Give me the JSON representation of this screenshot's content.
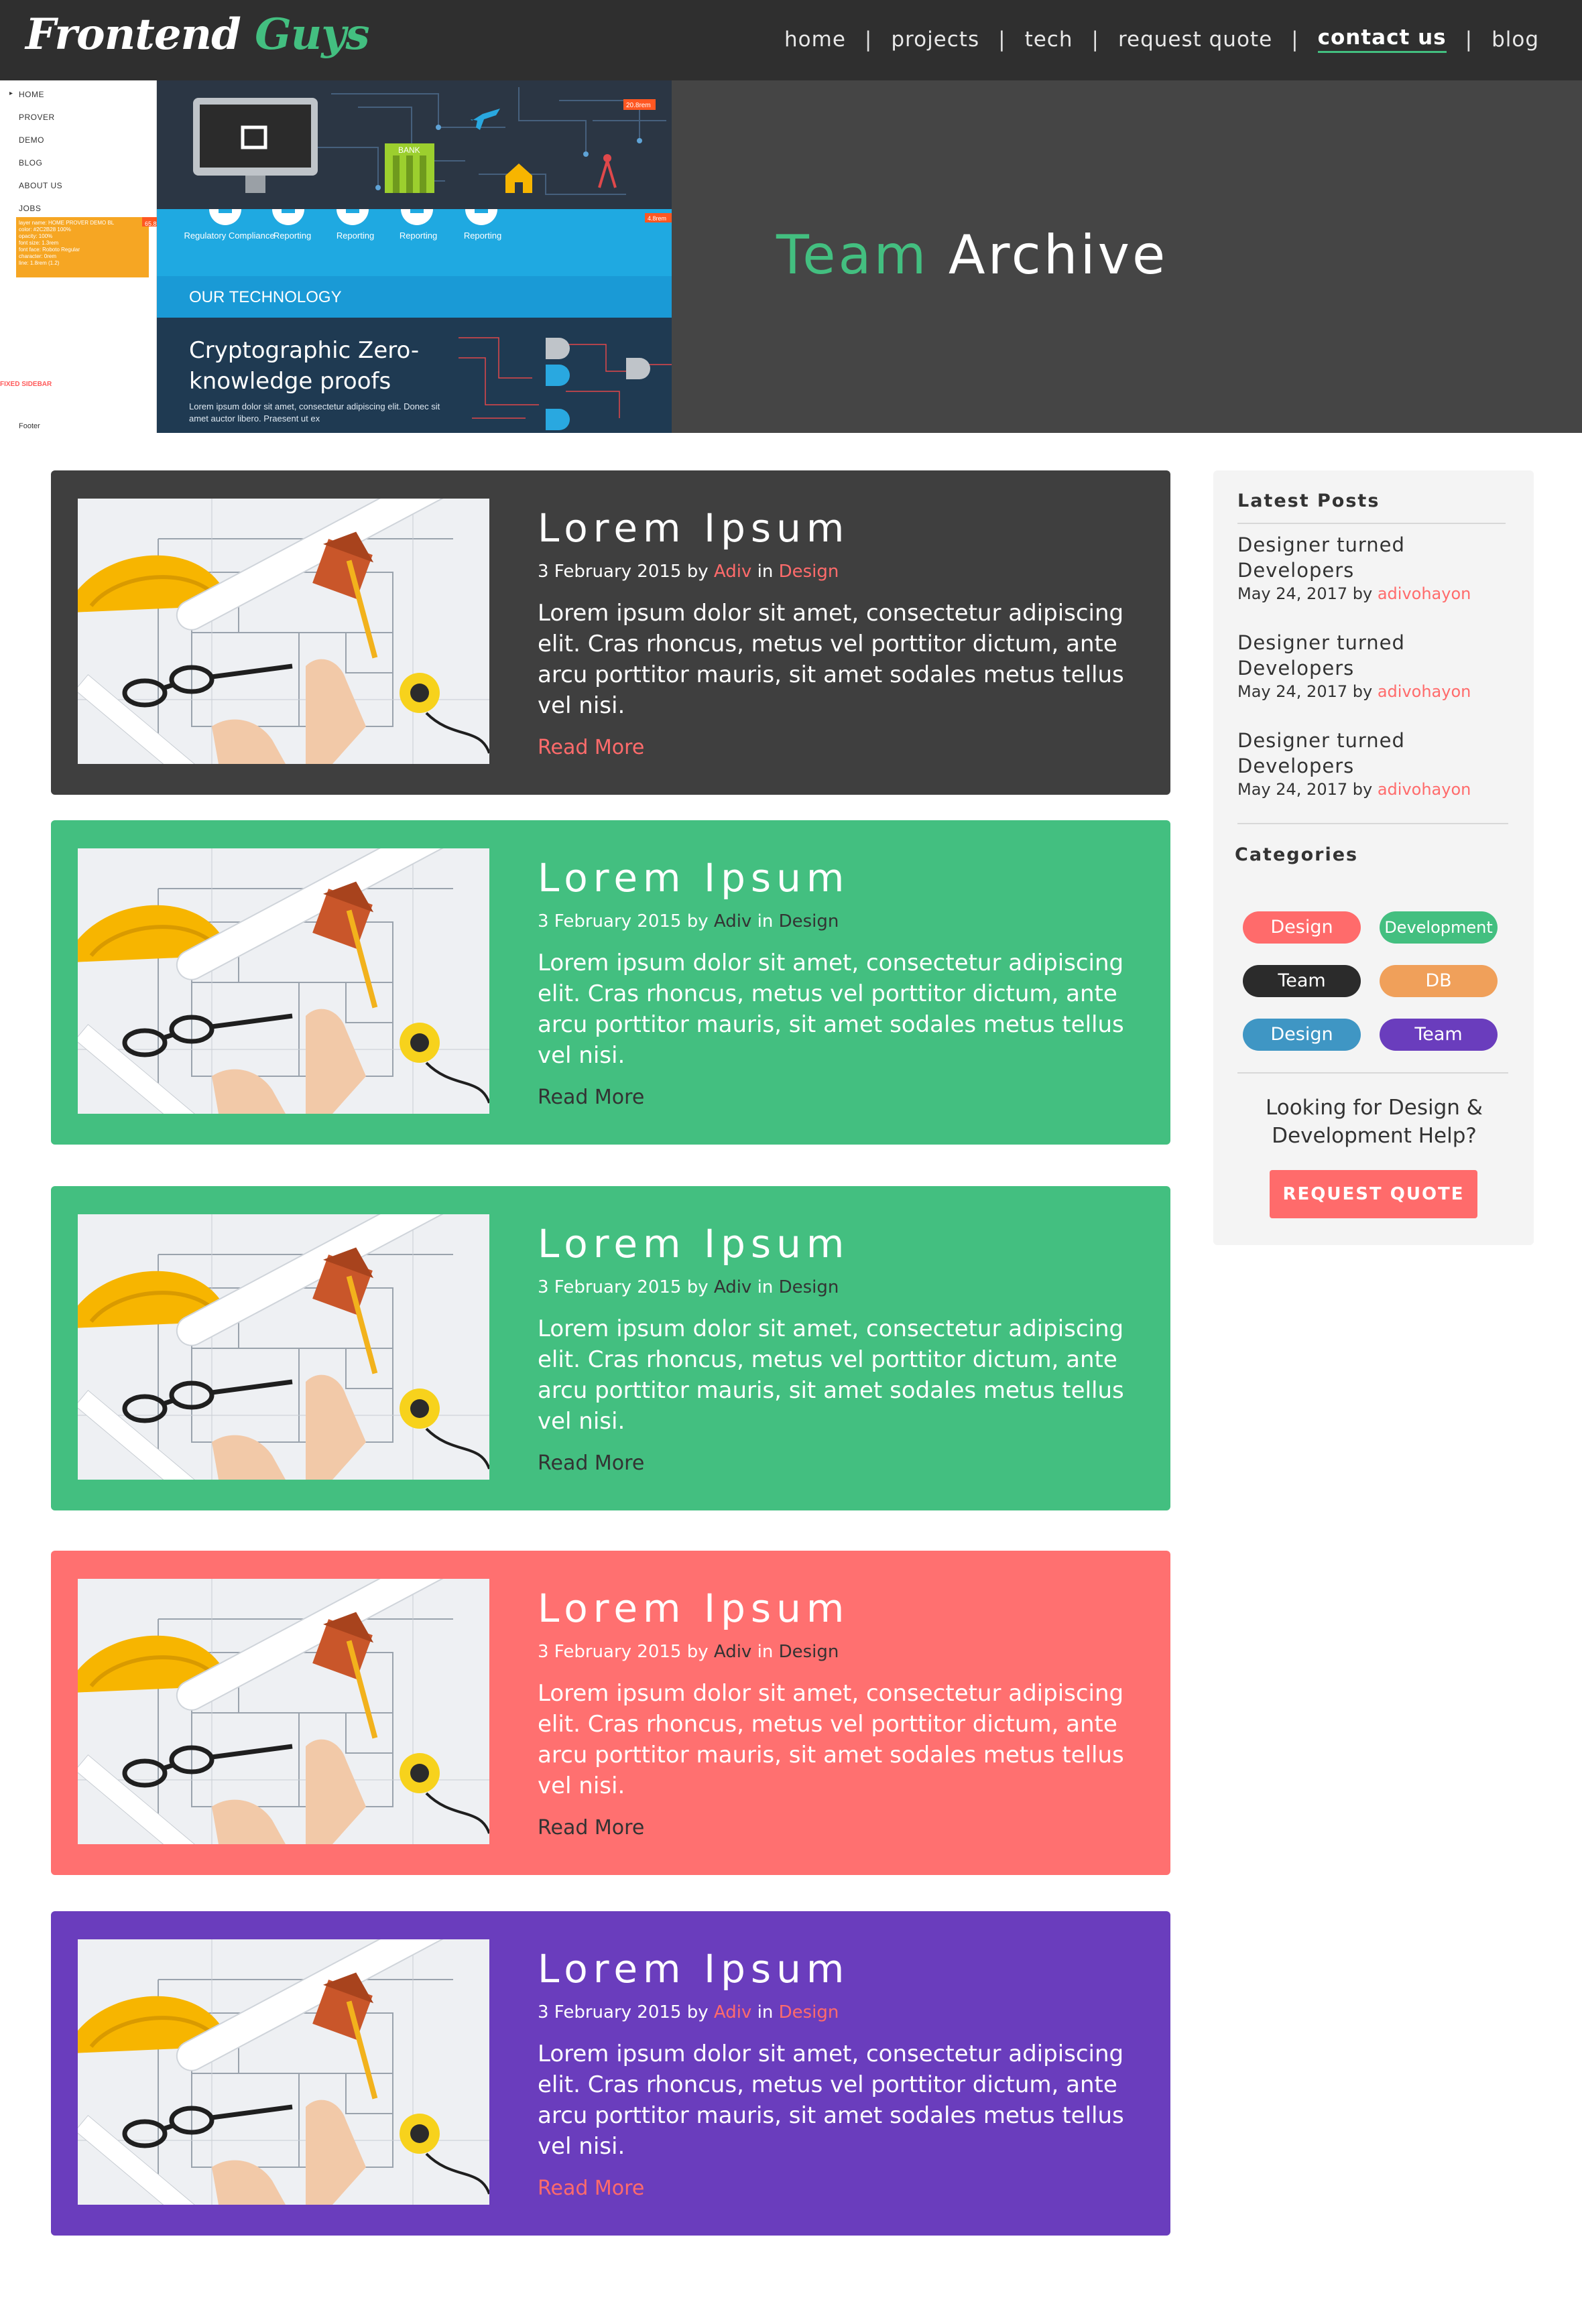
{
  "brand": {
    "logo_part1": "Frontend",
    "logo_part2": "Guys"
  },
  "nav": {
    "items": [
      {
        "label": "home"
      },
      {
        "label": "projects"
      },
      {
        "label": "tech"
      },
      {
        "label": "request quote"
      },
      {
        "label": "contact us",
        "active": true
      },
      {
        "label": "blog"
      }
    ],
    "separator": "|"
  },
  "hero": {
    "title_accent": "Team",
    "title_rest": "Archive",
    "collage": {
      "menu": [
        "HOME",
        "PROVER",
        "DEMO",
        "BLOG",
        "ABOUT US",
        "JOBS"
      ],
      "menu_arrow": "▸",
      "orange_lines": [
        "layer name: HOME PROVER DEMO BL",
        "color: #2C2B28 100%",
        "opacity: 100%",
        "font size: 1.3rem",
        "font face: Roboto Regular",
        "character: 0rem",
        "line: 1.8rem (1.2)"
      ],
      "orange_tag": "65.8rem",
      "circuit_tag": "20.8rem",
      "band_tag": "4.8rem",
      "fixed_sidebar": "FIXED SIDEBAR",
      "footer": "Footer",
      "bank": "BANK",
      "icon_labels": [
        "Regulatory Compliance",
        "Reporting",
        "Reporting",
        "Reporting",
        "Reporting"
      ],
      "our_technology": "OUR TECHNOLOGY",
      "zk_title": "Cryptographic Zero-knowledge proofs",
      "zk_text": "Lorem ipsum dolor sit amet, consectetur adipiscing elit. Donec sit amet auctor libero. Praesent ut ex"
    }
  },
  "posts": [
    {
      "title": "Lorem Ipsum",
      "date": "3 February 2015",
      "by": "by",
      "author": "Adiv",
      "in": "in",
      "category": "Design",
      "excerpt": "Lorem ipsum dolor sit amet, consectetur adipiscing elit. Cras rhoncus, metus vel porttitor dictum, ante arcu porttitor mauris, sit amet sodales metus tellus vel nisi.",
      "read_more": "Read More",
      "bg": "#3f3f3f",
      "accent": "#ff6b6b"
    },
    {
      "title": "Lorem Ipsum",
      "date": "3 February 2015",
      "by": "by",
      "author": "Adiv",
      "in": "in",
      "category": "Design",
      "excerpt": "Lorem ipsum dolor sit amet, consectetur adipiscing elit. Cras rhoncus, metus vel porttitor dictum, ante arcu porttitor mauris, sit amet sodales metus tellus vel nisi.",
      "read_more": "Read More",
      "bg": "#43bf80",
      "accent": "#333333"
    },
    {
      "title": "Lorem Ipsum",
      "date": "3 February 2015",
      "by": "by",
      "author": "Adiv",
      "in": "in",
      "category": "Design",
      "excerpt": "Lorem ipsum dolor sit amet, consectetur adipiscing elit. Cras rhoncus, metus vel porttitor dictum, ante arcu porttitor mauris, sit amet sodales metus tellus vel nisi.",
      "read_more": "Read More",
      "bg": "#43bf80",
      "accent": "#333333"
    },
    {
      "title": "Lorem Ipsum",
      "date": "3 February 2015",
      "by": "by",
      "author": "Adiv",
      "in": "in",
      "category": "Design",
      "excerpt": "Lorem ipsum dolor sit amet, consectetur adipiscing elit. Cras rhoncus, metus vel porttitor dictum, ante arcu porttitor mauris, sit amet sodales metus tellus vel nisi.",
      "read_more": "Read More",
      "bg": "#ff7070",
      "accent": "#333333"
    },
    {
      "title": "Lorem Ipsum",
      "date": "3 February 2015",
      "by": "by",
      "author": "Adiv",
      "in": "in",
      "category": "Design",
      "excerpt": "Lorem ipsum dolor sit amet, consectetur adipiscing elit. Cras rhoncus, metus vel porttitor dictum, ante arcu porttitor mauris, sit amet sodales metus tellus vel nisi.",
      "read_more": "Read More",
      "bg": "#6a3dbd",
      "accent": "#ff6b6b"
    }
  ],
  "sidebar": {
    "latest_heading": "Latest Posts",
    "latest": [
      {
        "title": "Designer turned Developers",
        "date": "May 24, 2017",
        "by": "by",
        "author": "adivohayon"
      },
      {
        "title": "Designer turned Developers",
        "date": "May 24, 2017",
        "by": "by",
        "author": "adivohayon"
      },
      {
        "title": "Designer turned Developers",
        "date": "May 24, 2017",
        "by": "by",
        "author": "adivohayon"
      }
    ],
    "categories_heading": "Categories",
    "categories": [
      {
        "label": "Design",
        "color": "#ff6b6b"
      },
      {
        "label": "Development",
        "color": "#43bf80"
      },
      {
        "label": "Team",
        "color": "#2b2b2b"
      },
      {
        "label": "DB",
        "color": "#f0a05a"
      },
      {
        "label": "Design",
        "color": "#3f96c4"
      },
      {
        "label": "Team",
        "color": "#6a3dbd"
      }
    ],
    "help_text": "Looking for Design & Development Help?",
    "quote_button": "REQUEST QUOTE"
  },
  "colors": {
    "header_bg": "#2f2f2f",
    "hero_bg": "#454545",
    "accent_green": "#43bf80",
    "accent_coral": "#ff6b6b"
  }
}
